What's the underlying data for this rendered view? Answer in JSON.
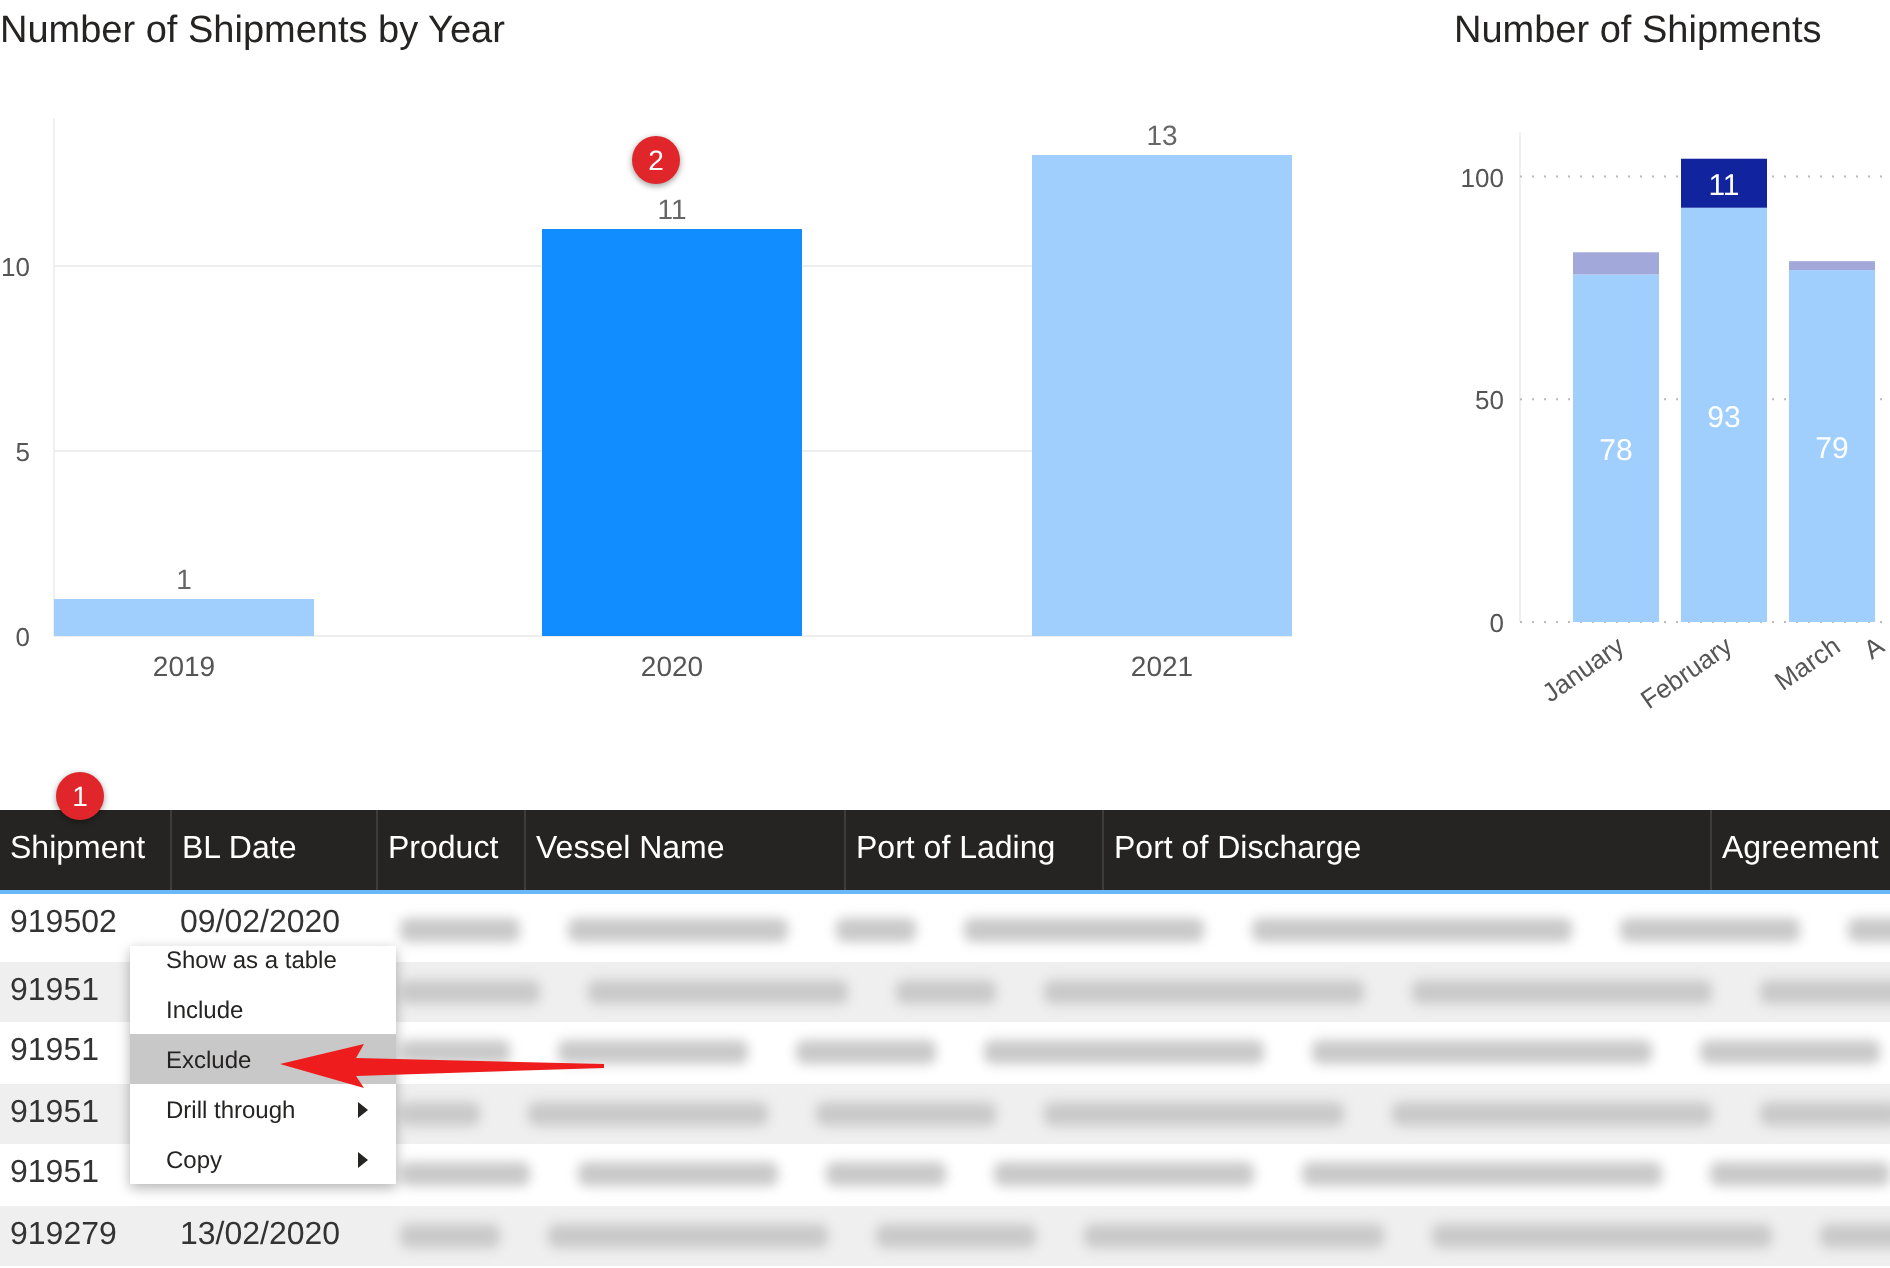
{
  "charts": [
    {
      "title": "Number of Shipments by Year",
      "badge": "2",
      "bars": [
        {
          "color": "#a0cffd"
        },
        {
          "color": "#118dff"
        },
        {
          "color": "#a0cffd"
        }
      ],
      "chart_data": {
        "type": "bar",
        "categories": [
          "2019",
          "2020",
          "2021"
        ],
        "series": [
          {
            "values": [
              1,
              11,
              13
            ]
          }
        ],
        "data_labels": true,
        "stacked": false,
        "ylim": [
          0,
          14
        ],
        "yticks": [
          0,
          5,
          10
        ]
      }
    },
    {
      "title": "Number of Shipments",
      "chart_data": {
        "type": "bar",
        "categories": [
          "January",
          "February",
          "March",
          "A"
        ],
        "series": [
          {
            "color": "#a0cffd",
            "values": [
              78,
              93,
              79,
              null
            ],
            "value_labels": [
              "78",
              "93",
              "79",
              null
            ]
          },
          {
            "color": "#a3a8db",
            "values": [
              5,
              null,
              2,
              null
            ],
            "value_labels": [
              null,
              null,
              null,
              null
            ]
          },
          {
            "color": "#12239e",
            "values": [
              null,
              11,
              null,
              null
            ],
            "value_labels": [
              null,
              "11",
              null,
              null
            ]
          }
        ],
        "stacked": true,
        "ylim": [
          0,
          110
        ],
        "yticks": [
          0,
          50,
          100
        ]
      }
    }
  ],
  "table": {
    "badge": "1",
    "columns": [
      "Shipment",
      "BL Date",
      "Product",
      "Vessel Name",
      "Port of Lading",
      "Port of Discharge",
      "Agreement"
    ],
    "rows": [
      {
        "shipment": "919502",
        "bl_date": "09/02/2020"
      },
      {
        "shipment": "91951"
      },
      {
        "shipment": "91951"
      },
      {
        "shipment": "91951"
      },
      {
        "shipment": "91951"
      },
      {
        "shipment": "919279",
        "bl_date": "13/02/2020"
      }
    ]
  },
  "context_menu": {
    "items": [
      {
        "label": "Show as a table",
        "selected": false,
        "has_submenu": false
      },
      {
        "label": "Include",
        "selected": false,
        "has_submenu": false
      },
      {
        "label": "Exclude",
        "selected": true,
        "has_submenu": false
      },
      {
        "label": "Drill through",
        "selected": false,
        "has_submenu": true
      },
      {
        "label": "Copy",
        "selected": false,
        "has_submenu": true
      }
    ]
  }
}
